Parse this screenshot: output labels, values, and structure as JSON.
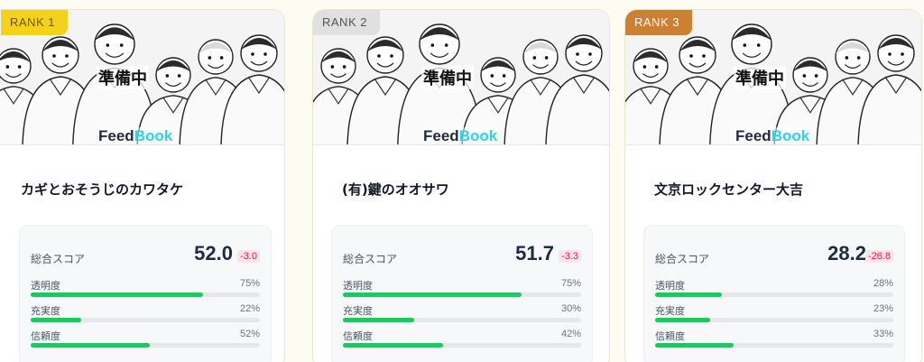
{
  "colors": {
    "rank_gold": "#f4d11a",
    "rank_silver": "#e0e0e0",
    "rank_bronze": "#cd7f32",
    "bar_fill": "#22c55e",
    "delta_negative": "#e11d48"
  },
  "cards": [
    {
      "rank_label": "RANK 1",
      "rank_color": "#f4d11a",
      "rank_text_color": "#6b5a00",
      "status_label": "準備中",
      "logo_feed": "Feed",
      "logo_book": "Book",
      "name": "カギとおそうじのカワタケ",
      "total_label": "総合スコア",
      "total_score": "52.0",
      "total_delta": "-3.0",
      "metrics": [
        {
          "label": "透明度",
          "pct_text": "75%",
          "value": 75
        },
        {
          "label": "充実度",
          "pct_text": "22%",
          "value": 22
        },
        {
          "label": "信頼度",
          "pct_text": "52%",
          "value": 52
        }
      ]
    },
    {
      "rank_label": "RANK 2",
      "rank_color": "#e0e0e0",
      "rank_text_color": "#555555",
      "status_label": "準備中",
      "logo_feed": "Feed",
      "logo_book": "Book",
      "name": "(有)鍵のオオサワ",
      "total_label": "総合スコア",
      "total_score": "51.7",
      "total_delta": "-3.3",
      "metrics": [
        {
          "label": "透明度",
          "pct_text": "75%",
          "value": 75
        },
        {
          "label": "充実度",
          "pct_text": "30%",
          "value": 30
        },
        {
          "label": "信頼度",
          "pct_text": "42%",
          "value": 42
        }
      ]
    },
    {
      "rank_label": "RANK 3",
      "rank_color": "#cd7f32",
      "rank_text_color": "#ffffff",
      "status_label": "準備中",
      "logo_feed": "Feed",
      "logo_book": "Book",
      "name": "文京ロックセンター大吉",
      "total_label": "総合スコア",
      "total_score": "28.2",
      "total_delta": "-26.8",
      "metrics": [
        {
          "label": "透明度",
          "pct_text": "28%",
          "value": 28
        },
        {
          "label": "充実度",
          "pct_text": "23%",
          "value": 23
        },
        {
          "label": "信頼度",
          "pct_text": "33%",
          "value": 33
        }
      ]
    }
  ]
}
